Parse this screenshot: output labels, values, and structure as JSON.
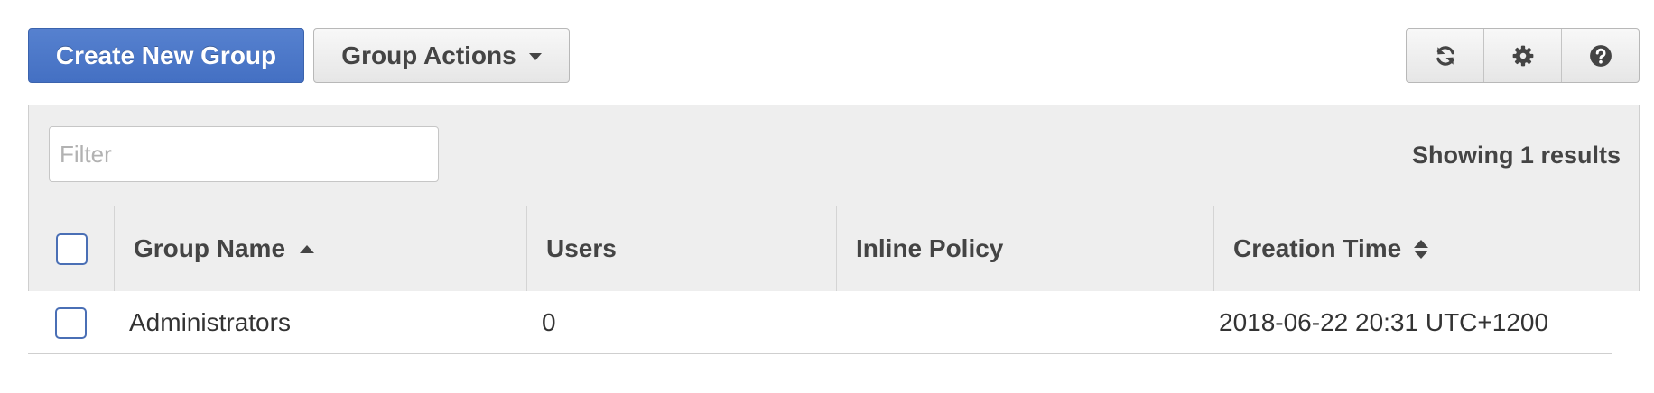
{
  "toolbar": {
    "create_label": "Create New Group",
    "actions_label": "Group Actions",
    "icons": [
      "refresh-icon",
      "gear-icon",
      "help-icon"
    ],
    "primary_color": "#4a77c9"
  },
  "filter": {
    "placeholder": "Filter",
    "value": ""
  },
  "results_text": "Showing 1 results",
  "table": {
    "columns": [
      "Group Name",
      "Users",
      "Inline Policy",
      "Creation Time"
    ],
    "sort": {
      "column": "Group Name",
      "direction": "ascending"
    },
    "rows": [
      {
        "name": "Administrators",
        "users": "0",
        "inline_policy": "",
        "creation_time": "2018-06-22 20:31 UTC+1200",
        "checked": false
      }
    ]
  }
}
